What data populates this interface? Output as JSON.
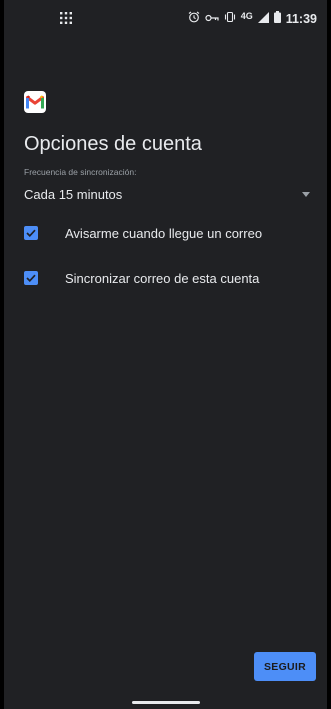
{
  "status_bar": {
    "time": "11:39",
    "network": "4G",
    "icons": [
      "app-grid-icon",
      "alarm-icon",
      "key-icon",
      "vibrate-icon",
      "signal-icon",
      "battery-icon"
    ]
  },
  "header": {
    "logo_icon": "gmail-logo",
    "title": "Opciones de cuenta"
  },
  "sync_frequency": {
    "label": "Frecuencia de sincronización:",
    "value": "Cada 15 minutos"
  },
  "options": [
    {
      "label": "Avisarme cuando llegue un correo",
      "checked": true
    },
    {
      "label": "Sincronizar correo de esta cuenta",
      "checked": true
    }
  ],
  "footer": {
    "next_button": "SEGUIR"
  },
  "colors": {
    "background": "#202124",
    "accent": "#4d8ef7",
    "text": "#e8eaed",
    "secondary_text": "#9aa0a6"
  }
}
